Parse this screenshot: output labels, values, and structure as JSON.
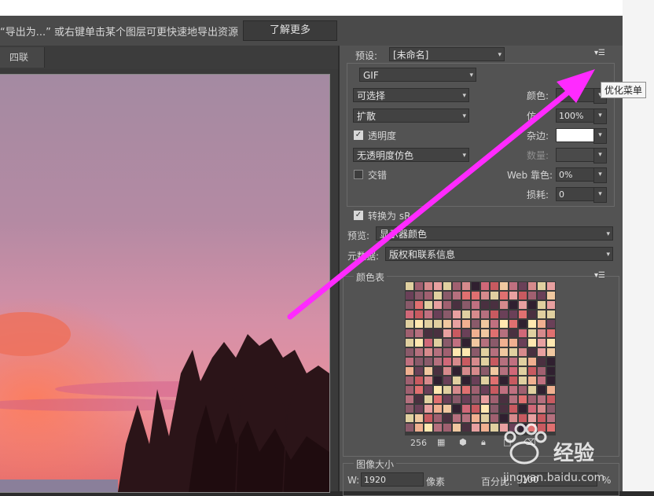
{
  "header": {
    "info_text": "“导出为...” 或右键单击某个图层可更快速地导出资源",
    "learn_more_label": "了解更多"
  },
  "tabs": {
    "four_up_label": "四联"
  },
  "settings": {
    "preset_label": "预设:",
    "preset_value": "[未命名]",
    "optimize_menu_tooltip": "优化菜单",
    "format_value": "GIF",
    "color_reduction_value": "可选择",
    "dither_method_value": "扩散",
    "transparency_label": "透明度",
    "transparency_checked": true,
    "transparency_dither_value": "无透明度仿色",
    "interlaced_label": "交错",
    "interlaced_checked": false,
    "colors_label": "颜色:",
    "dither_label": "仿",
    "dither_value": "100%",
    "matte_label": "杂边:",
    "matte_color": "#ffffff",
    "amount_label": "数量:",
    "web_snap_label": "Web 靠色:",
    "web_snap_value": "0%",
    "lossy_label": "损耗:",
    "lossy_value": "0",
    "convert_srgb_label": "转换为 sR",
    "convert_srgb_checked": true,
    "preview_label": "预览:",
    "preview_value": "显示器颜色",
    "metadata_label": "元数据:",
    "metadata_value": "版权和联系信息"
  },
  "color_table": {
    "title": "颜色表",
    "count": "256"
  },
  "image_size": {
    "title": "图像大小",
    "width_label": "W:",
    "width_value": "1920",
    "width_unit": "像素",
    "percent_label": "百分比:",
    "percent_value": "100",
    "percent_unit": "%"
  },
  "watermark": {
    "brand": "经验",
    "url": "jingyan.baidu.com"
  },
  "colors": {
    "panel_bg": "#535353",
    "annotation_arrow": "#ff2aff"
  },
  "icons": [
    "menu-icon",
    "chevron-down-icon",
    "checkmark-icon",
    "web-safe-icon",
    "map-cube-icon",
    "lock-icon",
    "add-icon",
    "delete-icon"
  ]
}
